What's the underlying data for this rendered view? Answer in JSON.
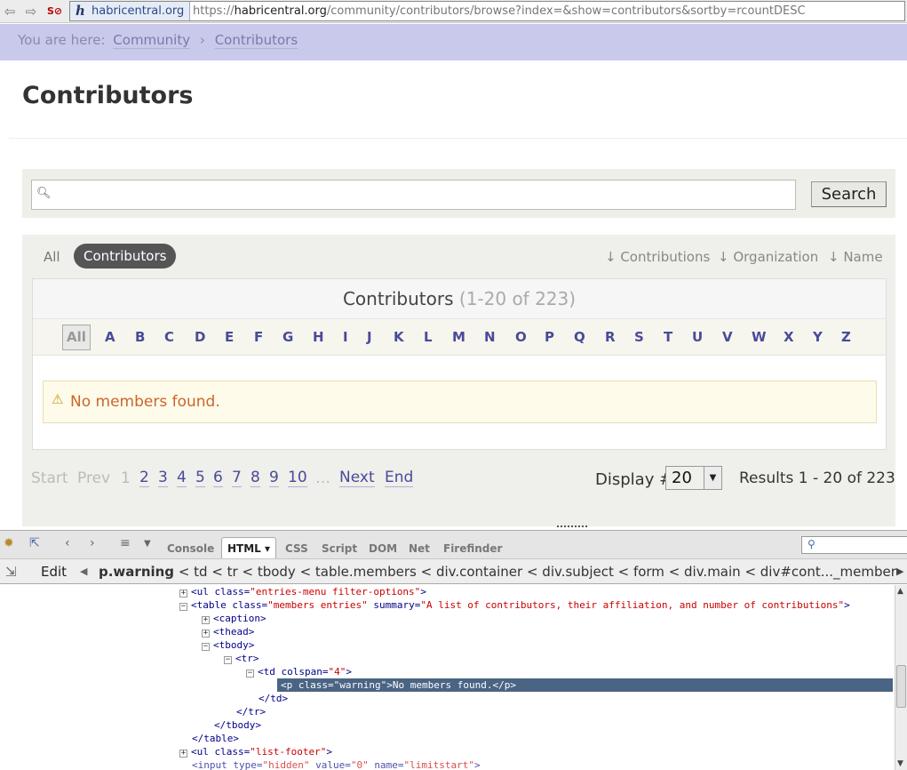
{
  "browser": {
    "identity": "habricentral.org",
    "url_domain_prefix": "https://",
    "url_domain": "habricentral.org",
    "url_path": "/community/contributors/browse?index=&show=contributors&sortby=rcountDESC"
  },
  "breadcrumb": {
    "prefix": "You are here:",
    "items": [
      "Community",
      "Contributors"
    ],
    "separator": "›"
  },
  "page": {
    "title": "Contributors"
  },
  "search": {
    "placeholder": "",
    "button_label": "Search"
  },
  "filters": {
    "all": "All",
    "contributors": "Contributors"
  },
  "sort": [
    "↓ Contributions",
    "↓ Organization",
    "↓ Name"
  ],
  "table": {
    "caption": "Contributors",
    "caption_count": "(1-20 of 223)",
    "letters": [
      "A",
      "B",
      "C",
      "D",
      "E",
      "F",
      "G",
      "H",
      "I",
      "J",
      "K",
      "L",
      "M",
      "N",
      "O",
      "P",
      "Q",
      "R",
      "S",
      "T",
      "U",
      "V",
      "W",
      "X",
      "Y",
      "Z"
    ],
    "letters_all": "All",
    "warning": "No members found."
  },
  "pagination": {
    "start": "Start",
    "prev": "Prev",
    "current": "1",
    "pages": [
      "2",
      "3",
      "4",
      "5",
      "6",
      "7",
      "8",
      "9",
      "10"
    ],
    "ellipsis": "…",
    "next": "Next",
    "end": "End",
    "display_label": "Display #",
    "display_value": "20",
    "results": "Results 1 - 20 of 223"
  },
  "firebug": {
    "tabs": [
      "Console",
      "HTML ▾",
      "CSS",
      "Script",
      "DOM",
      "Net",
      "Firefinder"
    ],
    "active_tab": "HTML ▾",
    "edit_label": "Edit",
    "crumbs": "p.warning < td < tr < tbody < table.members < div.container < div.subject < form < div.main < div#cont..._members < div#w",
    "crumb_current": "p.warning"
  }
}
